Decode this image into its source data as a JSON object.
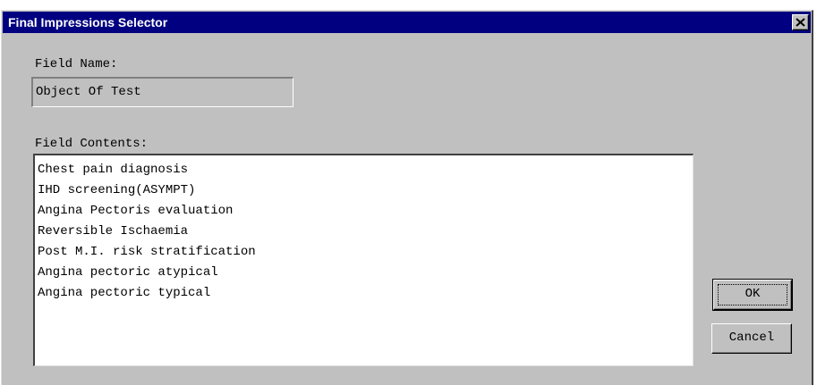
{
  "window": {
    "title": "Final Impressions Selector"
  },
  "field_name": {
    "label": "Field Name:",
    "value": "Object Of Test"
  },
  "field_contents": {
    "label": "Field Contents:",
    "items": [
      "Chest pain diagnosis",
      "IHD screening(ASYMPT)",
      "Angina Pectoris evaluation",
      "Reversible Ischaemia",
      "Post M.I. risk stratification",
      "Angina pectoric atypical",
      "Angina pectoric typical"
    ]
  },
  "buttons": {
    "ok_label": "OK",
    "cancel_label": "Cancel"
  },
  "colors": {
    "titlebar": "#000080",
    "dialog_face": "#c0c0c0"
  },
  "icons": {
    "close": "close-icon"
  }
}
